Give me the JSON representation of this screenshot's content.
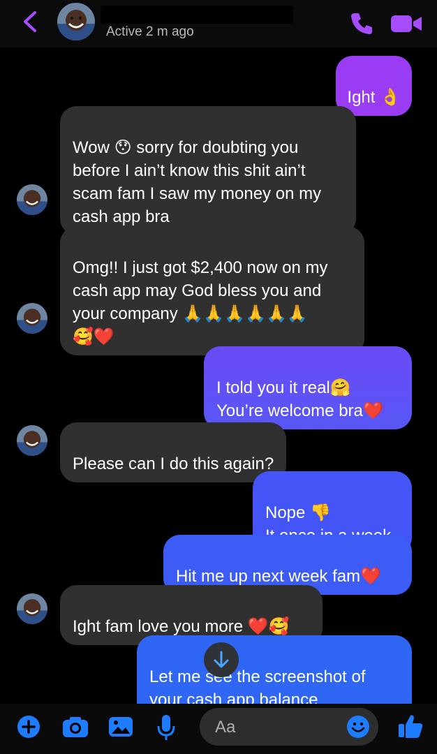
{
  "header": {
    "status": "Active 2 m ago"
  },
  "messages": [
    {
      "id": "m1",
      "dir": "out",
      "text": "Ight 👌"
    },
    {
      "id": "m2",
      "dir": "in",
      "text": "Wow 😯 sorry for doubting you\nbefore I ain’t know this shit ain’t\nscam fam I saw my money on my\ncash app bra"
    },
    {
      "id": "m3",
      "dir": "in",
      "text": "Omg!! I just got $2,400 now on my\ncash app may God bless you and\nyour company 🙏🙏🙏🙏🙏🙏\n🥰❤️"
    },
    {
      "id": "m4",
      "dir": "out",
      "text": "I told you it real🤗\nYou’re welcome bra❤️"
    },
    {
      "id": "m5",
      "dir": "in",
      "text": "Please can I do this again?"
    },
    {
      "id": "m6",
      "dir": "out",
      "text": "Nope 👎\nIt once in a week"
    },
    {
      "id": "m7",
      "dir": "out",
      "text": "Hit me up next week fam❤️"
    },
    {
      "id": "m8",
      "dir": "in",
      "text": "Ight fam love you more ❤️🥰"
    },
    {
      "id": "m9",
      "dir": "out",
      "text": "Let me see the screenshot of\nyour cash app balance"
    }
  ],
  "composer": {
    "placeholder": "Aa"
  },
  "colors": {
    "accent": "#a64dff",
    "bubble_in": "#303030",
    "bubble_out_purple": "#9b3cf5",
    "bubble_out_blue": "#3d5cf6"
  }
}
